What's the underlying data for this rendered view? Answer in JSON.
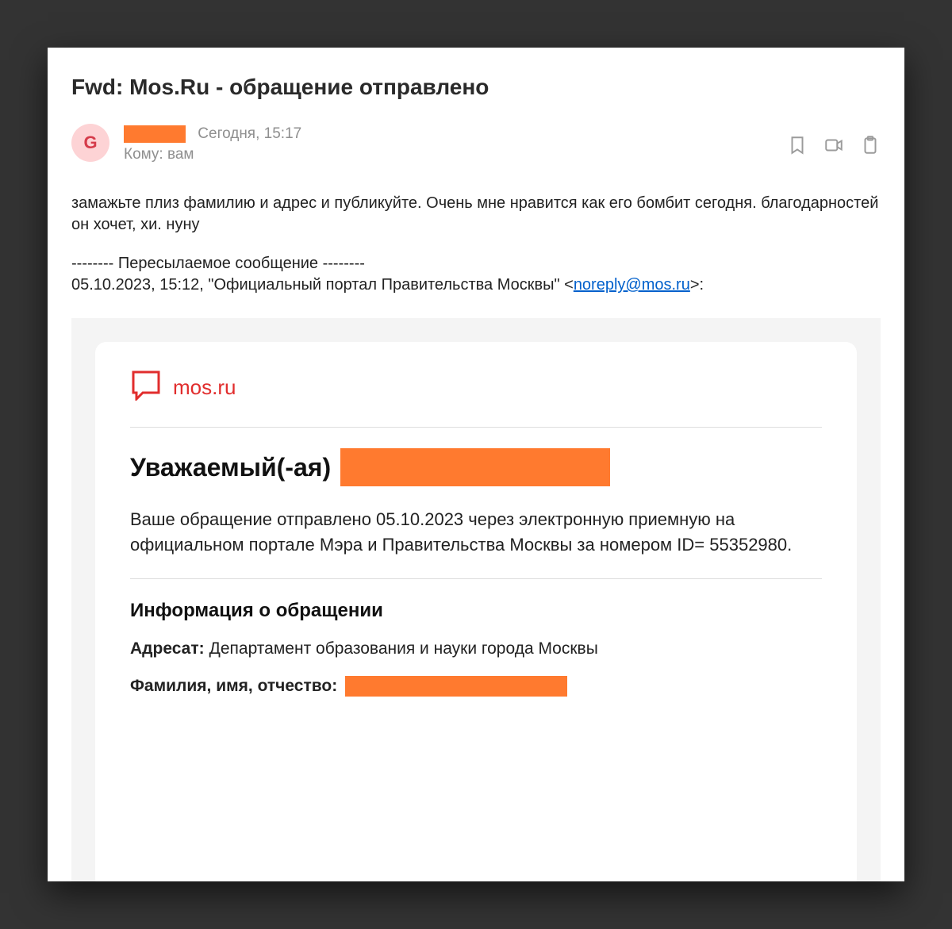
{
  "email": {
    "subject": "Fwd: Mos.Ru - обращение отправлено",
    "avatar_letter": "G",
    "date_line": "Сегодня, 15:17",
    "to_label": "Кому: ",
    "to_value": "вам",
    "body_paragraph": "замажьте плиз фамилию и адрес и публикуйте. Очень мне нравится как его бомбит сегодня. благодарностей он хочет, хи. нуну",
    "forward_divider": "-------- Пересылаемое сообщение --------",
    "forward_meta_prefix": "05.10.2023, 15:12, \"Официальный портал Правительства Москвы\" <",
    "forward_email": "noreply@mos.ru",
    "forward_meta_suffix": ">:"
  },
  "embedded": {
    "logo_text": "mos.ru",
    "greeting": "Уважаемый(-ая)",
    "appeal_text": "Ваше обращение отправлено 05.10.2023 через электронную приемную на официальном портале Мэра и Правительства Москвы за номером ID= 55352980.",
    "info_heading": "Информация о обращении",
    "addressee_label": "Адресат:",
    "addressee_value": "Департамент образования и науки города Москвы",
    "fio_label": "Фамилия, имя, отчество:"
  }
}
